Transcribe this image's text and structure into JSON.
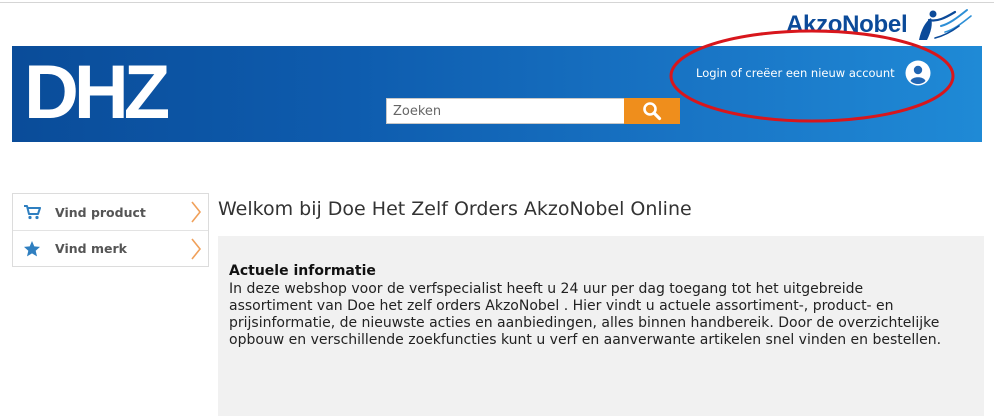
{
  "brand": {
    "name": "AkzoNobel",
    "color": "#0b4a99"
  },
  "header": {
    "logo_text": "DHZ",
    "search": {
      "placeholder": "Zoeken",
      "button_icon": "search-icon",
      "button_color": "#ef8e1c"
    },
    "login": {
      "label": "Login of creëer een nieuw account",
      "icon": "user-icon"
    },
    "annotation_color": "#d8161c"
  },
  "sidebar": {
    "items": [
      {
        "label": "Vind product",
        "icon": "cart-icon"
      },
      {
        "label": "Vind merk",
        "icon": "star-icon"
      }
    ],
    "icon_color": "#2f7fc0",
    "chevron_color": "#f0a05a"
  },
  "main": {
    "title": "Welkom bij Doe Het Zelf Orders AkzoNobel Online",
    "info": {
      "heading": "Actuele informatie",
      "body": "In deze webshop voor de verfspecialist heeft u 24 uur per dag toegang tot het uitgebreide assortiment van Doe het zelf orders AkzoNobel . Hier vindt u actuele assortiment-, product- en prijsinformatie, de nieuwste acties en aanbiedingen, alles binnen handbereik. Door de overzichtelijke opbouw en verschillende zoekfuncties kunt u verf en aanverwante artikelen snel vinden en bestellen."
    }
  }
}
